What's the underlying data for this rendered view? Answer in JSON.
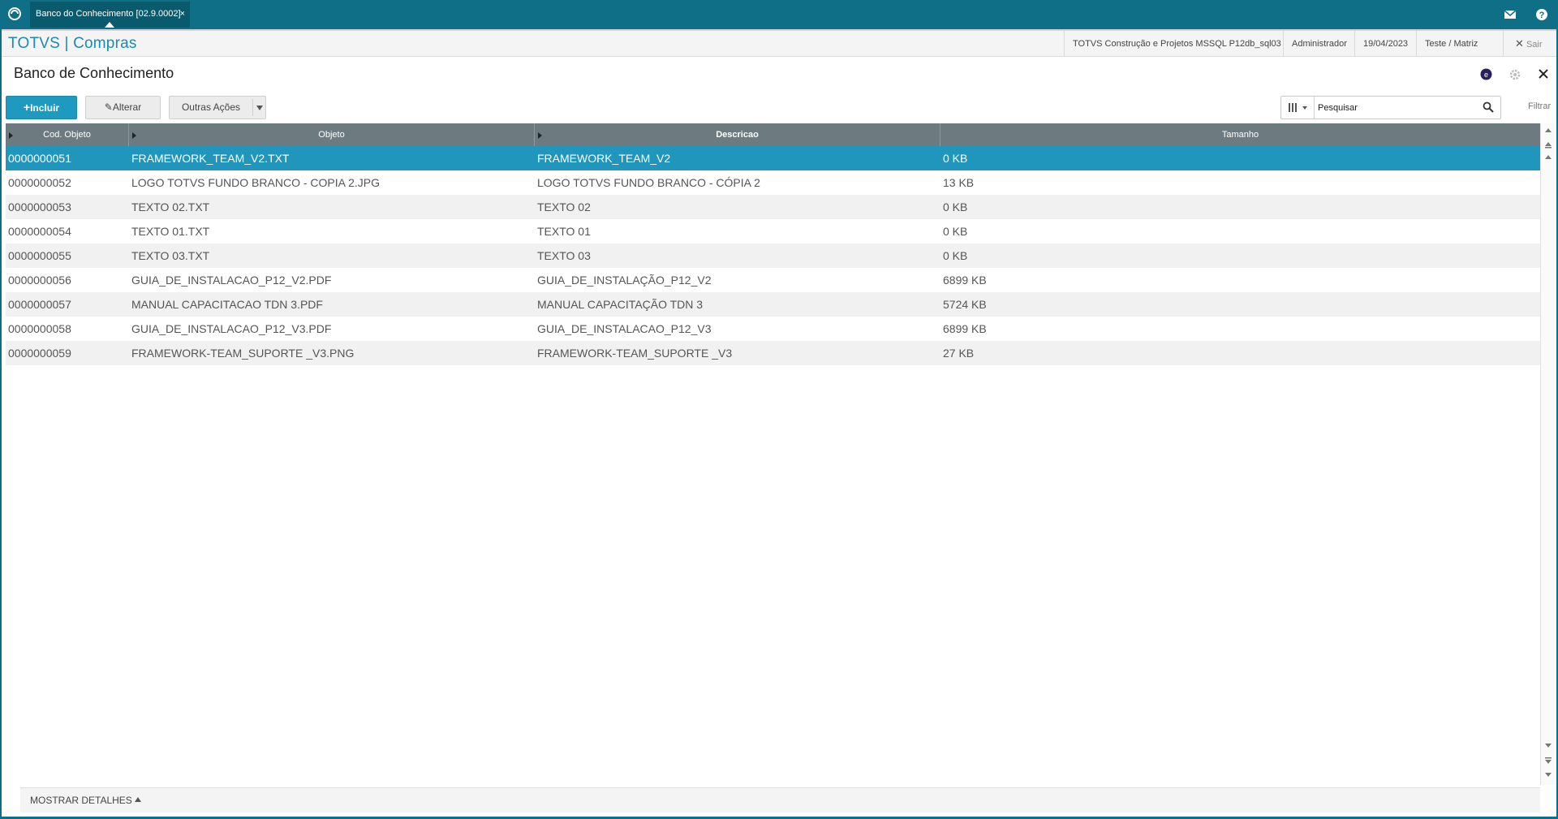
{
  "topbar": {
    "tab_label": "Banco do Conhecimento [02.9.0002]",
    "tab_close": "×",
    "icons": [
      "app-logo-icon",
      "mail-icon",
      "help-icon"
    ]
  },
  "header": {
    "brand": "TOTVS | Compras",
    "company": "TOTVS Construção e Projetos MSSQL P12db_sql03",
    "user": "Administrador",
    "date": "19/04/2023",
    "branch": "Teste / Matriz",
    "exit_label": "Sair"
  },
  "page": {
    "title": "Banco de Conhecimento",
    "title_icons": [
      "info-badge-icon",
      "gear-icon",
      "close-icon"
    ]
  },
  "toolbar": {
    "incluir_label": "Incluir",
    "alterar_label": "Alterar",
    "outras_label": "Outras Ações",
    "search_placeholder": "Pesquisar",
    "filter_label": "Filtrar"
  },
  "grid": {
    "columns": [
      "Cod. Objeto",
      "Objeto",
      "Descricao",
      "Tamanho"
    ],
    "selected_row": 0,
    "rows": [
      {
        "cod": "0000000051",
        "objeto": "FRAMEWORK_TEAM_V2.TXT",
        "descricao": "FRAMEWORK_TEAM_V2",
        "tamanho": "0 KB"
      },
      {
        "cod": "0000000052",
        "objeto": "LOGO TOTVS FUNDO BRANCO - COPIA 2.JPG",
        "descricao": "LOGO TOTVS FUNDO BRANCO - CÓPIA 2",
        "tamanho": "13 KB"
      },
      {
        "cod": "0000000053",
        "objeto": "TEXTO 02.TXT",
        "descricao": "TEXTO 02",
        "tamanho": "0 KB"
      },
      {
        "cod": "0000000054",
        "objeto": "TEXTO 01.TXT",
        "descricao": "TEXTO 01",
        "tamanho": "0 KB"
      },
      {
        "cod": "0000000055",
        "objeto": "TEXTO 03.TXT",
        "descricao": "TEXTO 03",
        "tamanho": "0 KB"
      },
      {
        "cod": "0000000056",
        "objeto": "GUIA_DE_INSTALACAO_P12_V2.PDF",
        "descricao": "GUIA_DE_INSTALAÇÃO_P12_V2",
        "tamanho": "6899 KB"
      },
      {
        "cod": "0000000057",
        "objeto": "MANUAL CAPACITACAO TDN 3.PDF",
        "descricao": "MANUAL CAPACITAÇÃO TDN 3",
        "tamanho": "5724 KB"
      },
      {
        "cod": "0000000058",
        "objeto": "GUIA_DE_INSTALACAO_P12_V3.PDF",
        "descricao": "GUIA_DE_INSTALACAO_P12_V3",
        "tamanho": "6899 KB"
      },
      {
        "cod": "0000000059",
        "objeto": "FRAMEWORK-TEAM_SUPORTE _V3.PNG",
        "descricao": "FRAMEWORK-TEAM_SUPORTE _V3",
        "tamanho": "27 KB"
      }
    ]
  },
  "details": {
    "label": "MOSTRAR DETALHES"
  },
  "colors": {
    "topbar": "#0e6f87",
    "brand": "#1b8ab0",
    "primary_button": "#1e9ac0",
    "selected_row": "#2196bd",
    "grid_header": "#6d7b81"
  }
}
